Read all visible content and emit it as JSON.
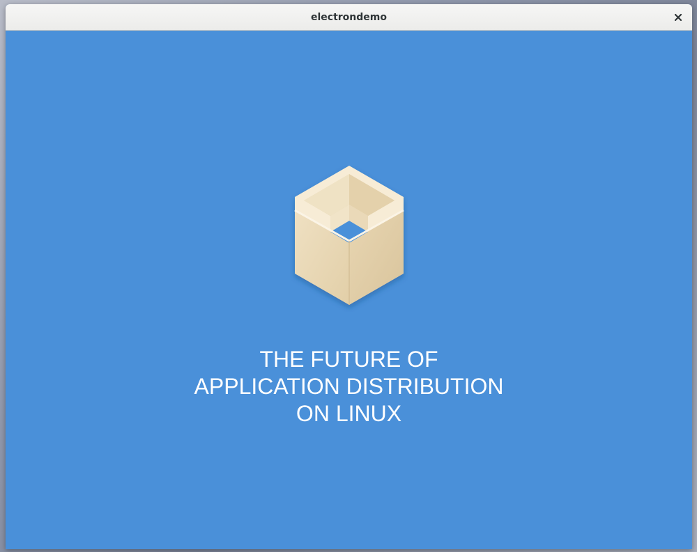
{
  "window": {
    "title": "electrondemo",
    "close_icon": "close-icon",
    "background_color": "#4a90d9"
  },
  "content": {
    "logo_icon": "flatpak-box-icon",
    "tagline": {
      "line1": "THE FUTURE OF",
      "line2": "APPLICATION DISTRIBUTION",
      "line3": "ON LINUX"
    }
  }
}
